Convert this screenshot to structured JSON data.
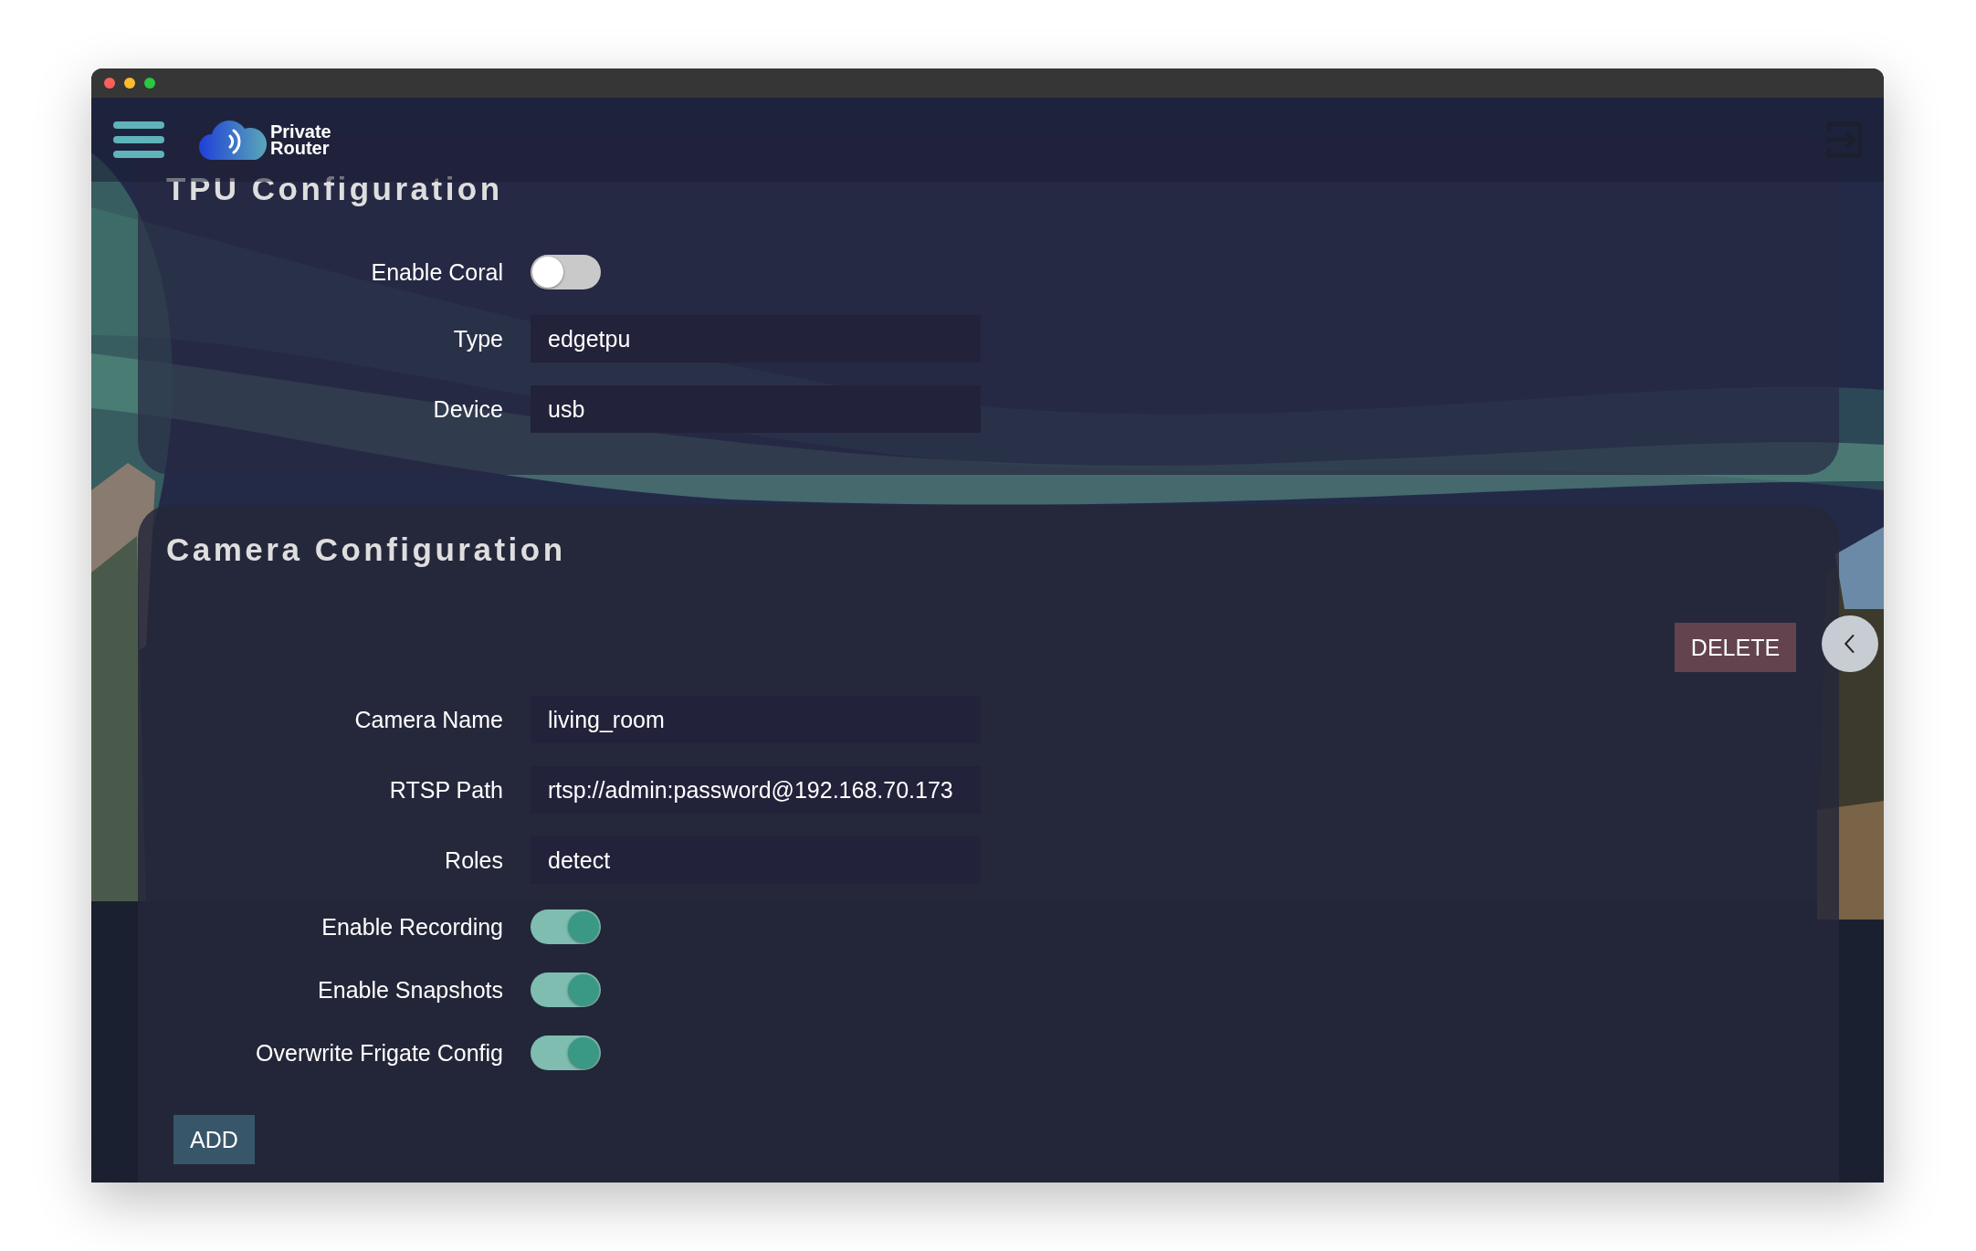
{
  "header": {
    "logo_lines": [
      "Private",
      "Router"
    ]
  },
  "tpu": {
    "title": "TPU Configuration",
    "fields": [
      {
        "kind": "toggle",
        "label": "Enable Coral",
        "on": false
      },
      {
        "kind": "text",
        "label": "Type",
        "value": "edgetpu"
      },
      {
        "kind": "text",
        "label": "Device",
        "value": "usb"
      }
    ]
  },
  "camera": {
    "title": "Camera Configuration",
    "delete_button": "DELETE",
    "fields": [
      {
        "kind": "text",
        "label": "Camera Name",
        "value": "living_room"
      },
      {
        "kind": "text",
        "label": "RTSP Path",
        "value": "rtsp://admin:password@192.168.70.173"
      },
      {
        "kind": "text",
        "label": "Roles",
        "value": "detect"
      },
      {
        "kind": "toggle",
        "label": "Enable Recording",
        "on": true
      },
      {
        "kind": "toggle",
        "label": "Enable Snapshots",
        "on": true
      },
      {
        "kind": "toggle",
        "label": "Overwrite Frigate Config",
        "on": true
      }
    ],
    "add_button": "ADD"
  }
}
